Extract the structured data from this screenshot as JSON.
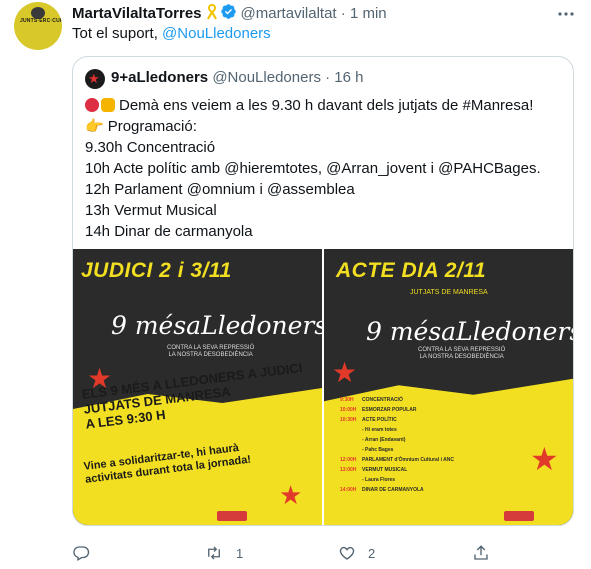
{
  "tweet": {
    "author_name": "MartaVilaltaTorres",
    "author_handle": "@martavilaltat",
    "separator": "·",
    "time": "1 min",
    "text_prefix": "Tot el suport, ",
    "text_mention": "@NouLledoners",
    "avatar_text": "JUNTS·ERC·CUP·SOM·FORTS"
  },
  "quoted": {
    "author_name": "9+aLledoners",
    "author_handle": "@NouLledoners",
    "separator": "·",
    "time": "16 h",
    "lines": {
      "l1": "Demà ens veiem a les 9.30 h davant dels jutjats de #Manresa!",
      "l2": "Programació:",
      "l3": "9.30h Concentració",
      "l4": "10h Acte polític amb @hieremtotes, @Arran_jovent i @PAHCBages.",
      "l5": "12h Parlament @omnium i @assemblea",
      "l6": "13h Vermut Musical",
      "l7": "14h Dinar de carmanyola"
    },
    "poster_left": {
      "title": "JUDICI 2 i 3/11",
      "script": "9 mésaLledoners",
      "small1": "CONTRA LA SEVA REPRESSIÓ",
      "small2": "LA NOSTRA DESOBEDIÈNCIA",
      "big1": "ELS 9 MÉS A LLEDONERS A JUDICI",
      "big2": "JUTJATS DE MANRESA",
      "big3": "A LES 9:30 H",
      "vine1": "Vine a solidaritzar-te, hi haurà",
      "vine2": "activitats durant tota la jornada!"
    },
    "poster_right": {
      "title": "ACTE DIA 2/11",
      "subtitle": "JUTJATS DE MANRESA",
      "script": "9 mésaLledoners",
      "small1": "CONTRA LA SEVA REPRESSIÓ",
      "small2": "LA NOSTRA DESOBEDIÈNCIA",
      "prog": [
        {
          "t": "9:30H",
          "d": "CONCENTRACIÓ"
        },
        {
          "t": "10:00H",
          "d": "ESMORZAR POPULAR"
        },
        {
          "t": "10:30H",
          "d": "ACTE POLÍTIC"
        },
        {
          "t": "",
          "d": "- Hi eram totes"
        },
        {
          "t": "",
          "d": "- Arran (Endavant)"
        },
        {
          "t": "",
          "d": "- Pahc Bages"
        },
        {
          "t": "12:00H",
          "d": "PARLAMENT d'Òmnium Cultural i ANC"
        },
        {
          "t": "13:00H",
          "d": "VERMUT MUSICAL"
        },
        {
          "t": "",
          "d": "- Laura Flores"
        },
        {
          "t": "14:00H",
          "d": "DINAR DE CARMANYOLA"
        }
      ]
    }
  },
  "actions": {
    "retweets": "1",
    "likes": "2"
  },
  "colors": {
    "mention": "#1d9bf0",
    "poster_yellow": "#f2df21",
    "verified": "#1d9bf0"
  }
}
